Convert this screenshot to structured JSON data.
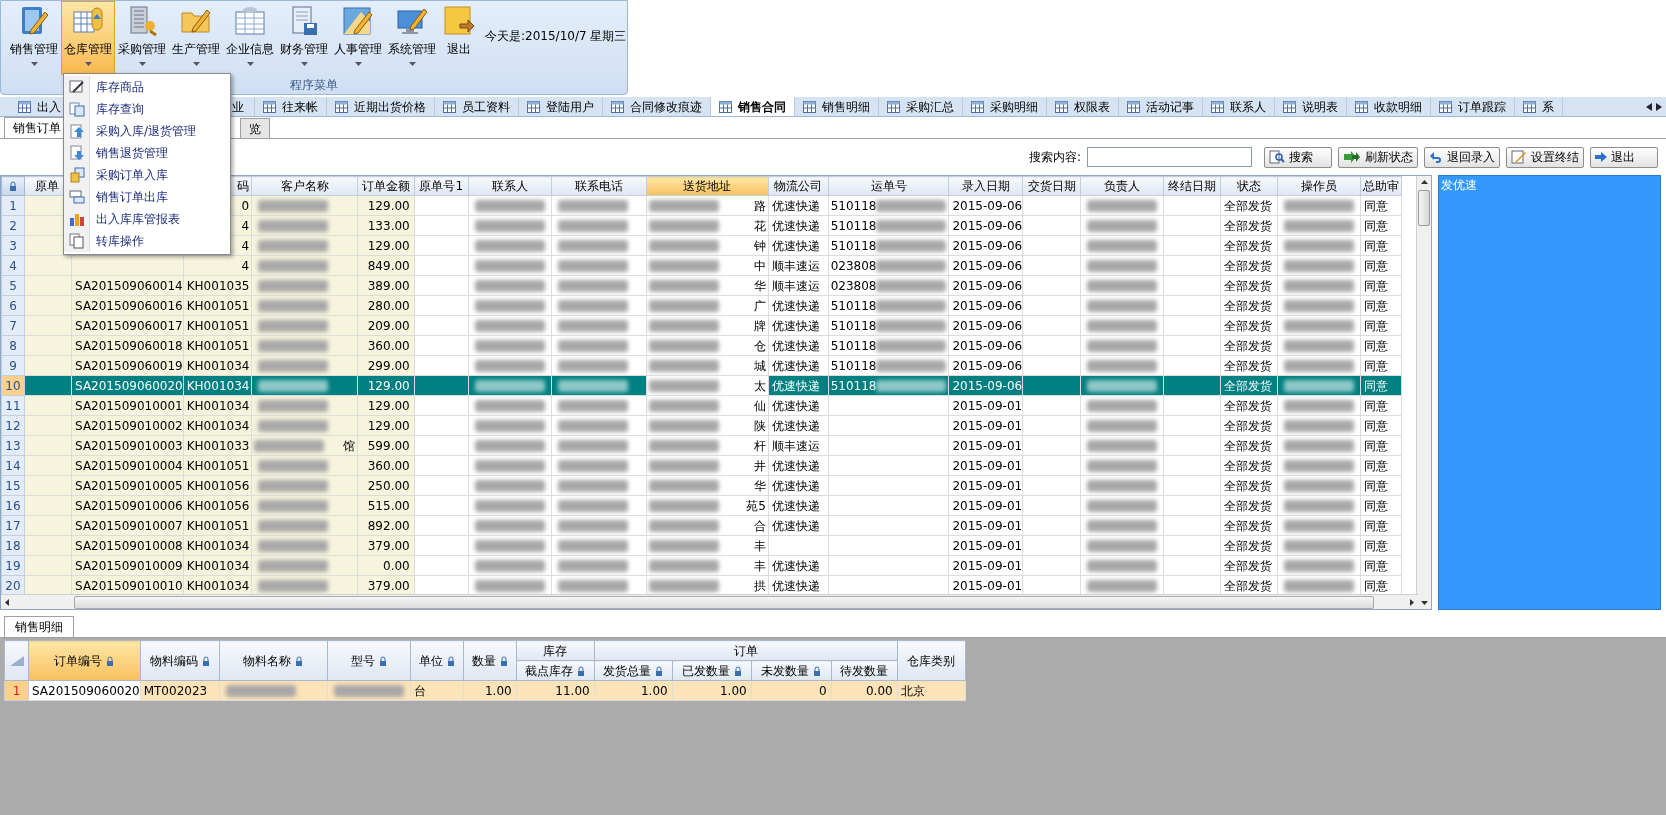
{
  "ribbon": {
    "buttons": [
      {
        "label": "销售管理",
        "selected": false,
        "dropdown": true
      },
      {
        "label": "仓库管理",
        "selected": true,
        "dropdown": true
      },
      {
        "label": "采购管理",
        "selected": false,
        "dropdown": true
      },
      {
        "label": "生产管理",
        "selected": false,
        "dropdown": true
      },
      {
        "label": "企业信息",
        "selected": false,
        "dropdown": true
      },
      {
        "label": "财务管理",
        "selected": false,
        "dropdown": true
      },
      {
        "label": "人事管理",
        "selected": false,
        "dropdown": true
      },
      {
        "label": "系统管理",
        "selected": false,
        "dropdown": true
      },
      {
        "label": "退出",
        "selected": false,
        "dropdown": false
      }
    ],
    "date": "今天是:2015/10/7 星期三",
    "group_label": "程序菜单"
  },
  "menu": {
    "items": [
      "库存商品",
      "库存查询",
      "采购入库/退货管理",
      "销售退货管理",
      "采购订单入库",
      "销售订单出库",
      "出入库库管报表",
      "转库操作"
    ]
  },
  "tabs": [
    {
      "label": "出入",
      "selected": false
    },
    {
      "label": "业",
      "selected": false
    },
    {
      "label": "往来帐",
      "selected": false
    },
    {
      "label": "近期出货价格",
      "selected": false
    },
    {
      "label": "员工资料",
      "selected": false
    },
    {
      "label": "登陆用户",
      "selected": false
    },
    {
      "label": "合同修改痕迹",
      "selected": false
    },
    {
      "label": "销售合同",
      "selected": true
    },
    {
      "label": "销售明细",
      "selected": false
    },
    {
      "label": "采购汇总",
      "selected": false
    },
    {
      "label": "采购明细",
      "selected": false
    },
    {
      "label": "权限表",
      "selected": false
    },
    {
      "label": "活动记事",
      "selected": false
    },
    {
      "label": "联系人",
      "selected": false
    },
    {
      "label": "说明表",
      "selected": false
    },
    {
      "label": "收款明细",
      "selected": false
    },
    {
      "label": "订单跟踪",
      "selected": false
    },
    {
      "label": "系",
      "selected": false
    }
  ],
  "sub_tabs": [
    {
      "label": "销售订单",
      "selected": true
    },
    {
      "label": "览",
      "selected": false
    }
  ],
  "toolbar": {
    "search_label": "搜索内容:",
    "buttons": [
      "搜索",
      "刷新状态",
      "退回录入",
      "设置终结",
      "退出"
    ]
  },
  "grid": {
    "columns": [
      {
        "label": "原单",
        "selected": false
      },
      {
        "selected": false
      },
      {
        "label": "码",
        "selected": false
      },
      {
        "label": "客户名称",
        "selected": false
      },
      {
        "label": "订单金额",
        "selected": false
      },
      {
        "label": "原单号1",
        "selected": false
      },
      {
        "label": "联系人",
        "selected": false
      },
      {
        "label": "联系电话",
        "selected": false
      },
      {
        "label": "送货地址",
        "selected": true
      },
      {
        "label": "物流公司",
        "selected": false
      },
      {
        "label": "运单号",
        "selected": false
      },
      {
        "label": "录入日期",
        "selected": false
      },
      {
        "label": "交货日期",
        "selected": false
      },
      {
        "label": "负责人",
        "selected": false
      },
      {
        "label": "终结日期",
        "selected": false
      },
      {
        "label": "状态",
        "selected": false
      },
      {
        "label": "操作员",
        "selected": false
      },
      {
        "label": "总助审",
        "selected": false
      }
    ],
    "rows": [
      {
        "number": "1",
        "selected": false,
        "cells": [
          null,
          null,
          "0",
          {
            "kind": "redacted"
          },
          "129.00",
          null,
          {
            "kind": "redacted"
          },
          {
            "kind": "redacted"
          },
          {
            "kind": "prefixed",
            "text": "路"
          },
          "优速快递",
          {
            "kind": "suffixed",
            "text": "510118"
          },
          "2015-09-06",
          null,
          {
            "kind": "redacted"
          },
          null,
          "全部发货",
          {
            "kind": "redacted"
          },
          "同意"
        ]
      },
      {
        "number": "2",
        "selected": false,
        "cells": [
          null,
          null,
          "4",
          {
            "kind": "redacted"
          },
          "133.00",
          null,
          {
            "kind": "redacted"
          },
          {
            "kind": "redacted"
          },
          {
            "kind": "prefixed",
            "text": "花"
          },
          "优速快递",
          {
            "kind": "suffixed",
            "text": "510118"
          },
          "2015-09-06",
          null,
          {
            "kind": "redacted"
          },
          null,
          "全部发货",
          {
            "kind": "redacted"
          },
          "同意"
        ]
      },
      {
        "number": "3",
        "selected": false,
        "cells": [
          null,
          null,
          "4",
          {
            "kind": "redacted"
          },
          "129.00",
          null,
          {
            "kind": "redacted"
          },
          {
            "kind": "redacted"
          },
          {
            "kind": "prefixed",
            "text": "钟"
          },
          "优速快递",
          {
            "kind": "suffixed",
            "text": "510118"
          },
          "2015-09-06",
          null,
          {
            "kind": "redacted"
          },
          null,
          "全部发货",
          {
            "kind": "redacted"
          },
          "同意"
        ]
      },
      {
        "number": "4",
        "selected": false,
        "cells": [
          null,
          null,
          "4",
          {
            "kind": "redacted"
          },
          "849.00",
          null,
          {
            "kind": "redacted"
          },
          {
            "kind": "redacted"
          },
          {
            "kind": "prefixed",
            "text": "中"
          },
          "顺丰速运",
          {
            "kind": "suffixed",
            "text": "023808"
          },
          "2015-09-06",
          null,
          {
            "kind": "redacted"
          },
          null,
          "全部发货",
          {
            "kind": "redacted"
          },
          "同意"
        ]
      },
      {
        "number": "5",
        "selected": false,
        "cells": [
          null,
          "SA201509060014",
          "KH001035",
          {
            "kind": "redacted"
          },
          "389.00",
          null,
          {
            "kind": "redacted"
          },
          {
            "kind": "redacted"
          },
          {
            "kind": "prefixed",
            "text": "华"
          },
          "顺丰速运",
          {
            "kind": "suffixed",
            "text": "023808"
          },
          "2015-09-06",
          null,
          {
            "kind": "redacted"
          },
          null,
          "全部发货",
          {
            "kind": "redacted"
          },
          "同意"
        ]
      },
      {
        "number": "6",
        "selected": false,
        "cells": [
          null,
          "SA201509060016",
          "KH001051",
          {
            "kind": "redacted"
          },
          "280.00",
          null,
          {
            "kind": "redacted"
          },
          {
            "kind": "redacted"
          },
          {
            "kind": "prefixed",
            "text": "广"
          },
          "优速快递",
          {
            "kind": "suffixed",
            "text": "510118"
          },
          "2015-09-06",
          null,
          {
            "kind": "redacted"
          },
          null,
          "全部发货",
          {
            "kind": "redacted"
          },
          "同意"
        ]
      },
      {
        "number": "7",
        "selected": false,
        "cells": [
          null,
          "SA201509060017",
          "KH001051",
          {
            "kind": "redacted"
          },
          "209.00",
          null,
          {
            "kind": "redacted"
          },
          {
            "kind": "redacted"
          },
          {
            "kind": "prefixed",
            "text": "牌"
          },
          "优速快递",
          {
            "kind": "suffixed",
            "text": "510118"
          },
          "2015-09-06",
          null,
          {
            "kind": "redacted"
          },
          null,
          "全部发货",
          {
            "kind": "redacted"
          },
          "同意"
        ]
      },
      {
        "number": "8",
        "selected": false,
        "cells": [
          null,
          "SA201509060018",
          "KH001051",
          {
            "kind": "redacted"
          },
          "360.00",
          null,
          {
            "kind": "redacted"
          },
          {
            "kind": "redacted"
          },
          {
            "kind": "prefixed",
            "text": "仓"
          },
          "优速快递",
          {
            "kind": "suffixed",
            "text": "510118"
          },
          "2015-09-06",
          null,
          {
            "kind": "redacted"
          },
          null,
          "全部发货",
          {
            "kind": "redacted"
          },
          "同意"
        ]
      },
      {
        "number": "9",
        "selected": false,
        "cells": [
          null,
          "SA201509060019",
          "KH001034",
          {
            "kind": "redacted"
          },
          "299.00",
          null,
          {
            "kind": "redacted"
          },
          {
            "kind": "redacted"
          },
          {
            "kind": "prefixed",
            "text": "城"
          },
          "优速快递",
          {
            "kind": "suffixed",
            "text": "510118"
          },
          "2015-09-06",
          null,
          {
            "kind": "redacted"
          },
          null,
          "全部发货",
          {
            "kind": "redacted"
          },
          "同意"
        ]
      },
      {
        "number": "10",
        "selected": true,
        "cells": [
          null,
          "SA201509060020",
          "KH001034",
          {
            "kind": "redacted"
          },
          "129.00",
          null,
          {
            "kind": "redacted"
          },
          {
            "kind": "redacted"
          },
          {
            "kind": "prefixed",
            "text": "太"
          },
          "优速快递",
          {
            "kind": "suffixed",
            "text": "510118"
          },
          "2015-09-06",
          null,
          {
            "kind": "redacted"
          },
          null,
          "全部发货",
          {
            "kind": "redacted"
          },
          "同意"
        ]
      },
      {
        "number": "11",
        "selected": false,
        "cells": [
          null,
          "SA201509010001",
          "KH001034",
          {
            "kind": "redacted"
          },
          "129.00",
          null,
          {
            "kind": "redacted"
          },
          {
            "kind": "redacted"
          },
          {
            "kind": "prefixed",
            "text": "仙"
          },
          "优速快递",
          null,
          "2015-09-01",
          null,
          {
            "kind": "redacted"
          },
          null,
          "全部发货",
          {
            "kind": "redacted"
          },
          "同意"
        ]
      },
      {
        "number": "12",
        "selected": false,
        "cells": [
          null,
          "SA201509010002",
          "KH001034",
          {
            "kind": "redacted"
          },
          "129.00",
          null,
          {
            "kind": "redacted"
          },
          {
            "kind": "redacted"
          },
          {
            "kind": "prefixed",
            "text": "陕"
          },
          "优速快递",
          null,
          "2015-09-01",
          null,
          {
            "kind": "redacted"
          },
          null,
          "全部发货",
          {
            "kind": "redacted"
          },
          "同意"
        ]
      },
      {
        "number": "13",
        "selected": false,
        "cells": [
          null,
          "SA201509010003",
          "KH001033",
          {
            "kind": "prefixed",
            "text": "馆"
          },
          "599.00",
          null,
          {
            "kind": "redacted"
          },
          {
            "kind": "redacted"
          },
          {
            "kind": "prefixed",
            "text": "杆"
          },
          "顺丰速运",
          null,
          "2015-09-01",
          null,
          {
            "kind": "redacted"
          },
          null,
          "全部发货",
          {
            "kind": "redacted"
          },
          "同意"
        ]
      },
      {
        "number": "14",
        "selected": false,
        "cells": [
          null,
          "SA201509010004",
          "KH001051",
          {
            "kind": "redacted"
          },
          "360.00",
          null,
          {
            "kind": "redacted"
          },
          {
            "kind": "redacted"
          },
          {
            "kind": "prefixed",
            "text": "井"
          },
          "优速快递",
          null,
          "2015-09-01",
          null,
          {
            "kind": "redacted"
          },
          null,
          "全部发货",
          {
            "kind": "redacted"
          },
          "同意"
        ]
      },
      {
        "number": "15",
        "selected": false,
        "cells": [
          null,
          "SA201509010005",
          "KH001056",
          {
            "kind": "redacted"
          },
          "250.00",
          null,
          {
            "kind": "redacted"
          },
          {
            "kind": "redacted"
          },
          {
            "kind": "prefixed",
            "text": "华"
          },
          "优速快递",
          null,
          "2015-09-01",
          null,
          {
            "kind": "redacted"
          },
          null,
          "全部发货",
          {
            "kind": "redacted"
          },
          "同意"
        ]
      },
      {
        "number": "16",
        "selected": false,
        "cells": [
          null,
          "SA201509010006",
          "KH001056",
          {
            "kind": "redacted"
          },
          "515.00",
          null,
          {
            "kind": "redacted"
          },
          {
            "kind": "redacted"
          },
          {
            "kind": "prefixed",
            "text": "苑5"
          },
          "优速快递",
          null,
          "2015-09-01",
          null,
          {
            "kind": "redacted"
          },
          null,
          "全部发货",
          {
            "kind": "redacted"
          },
          "同意"
        ]
      },
      {
        "number": "17",
        "selected": false,
        "cells": [
          null,
          "SA201509010007",
          "KH001051",
          {
            "kind": "redacted"
          },
          "892.00",
          null,
          {
            "kind": "redacted"
          },
          {
            "kind": "redacted"
          },
          {
            "kind": "prefixed",
            "text": "合"
          },
          "优速快递",
          null,
          "2015-09-01",
          null,
          {
            "kind": "redacted"
          },
          null,
          "全部发货",
          {
            "kind": "redacted"
          },
          "同意"
        ]
      },
      {
        "number": "18",
        "selected": false,
        "cells": [
          null,
          "SA201509010008",
          "KH001034",
          {
            "kind": "redacted"
          },
          "379.00",
          null,
          {
            "kind": "redacted"
          },
          {
            "kind": "redacted"
          },
          {
            "kind": "prefixed",
            "text": "丰"
          },
          null,
          null,
          "2015-09-01",
          null,
          {
            "kind": "redacted"
          },
          null,
          "全部发货",
          {
            "kind": "redacted"
          },
          "同意"
        ]
      },
      {
        "number": "19",
        "selected": false,
        "cells": [
          null,
          "SA201509010009",
          "KH001034",
          {
            "kind": "redacted"
          },
          "0.00",
          null,
          {
            "kind": "redacted"
          },
          {
            "kind": "redacted"
          },
          {
            "kind": "prefixed",
            "text": "丰"
          },
          "优速快递",
          null,
          "2015-09-01",
          null,
          {
            "kind": "redacted"
          },
          null,
          "全部发货",
          {
            "kind": "redacted"
          },
          "同意"
        ]
      },
      {
        "number": "20",
        "selected": false,
        "cells": [
          null,
          "SA201509010010",
          "KH001034",
          {
            "kind": "redacted"
          },
          "379.00",
          null,
          {
            "kind": "redacted"
          },
          {
            "kind": "redacted"
          },
          {
            "kind": "prefixed",
            "text": "拱"
          },
          "优速快递",
          null,
          "2015-09-01",
          null,
          {
            "kind": "redacted"
          },
          null,
          "全部发货",
          {
            "kind": "redacted"
          },
          "同意"
        ]
      }
    ]
  },
  "side_panel": {
    "text": "发优速"
  },
  "detail": {
    "tab": "销售明细",
    "header": [
      {
        "kind": "column",
        "label": "订单编号",
        "lock": true,
        "selected": true
      },
      {
        "kind": "column",
        "label": "物料编码",
        "lock": true,
        "selected": false
      },
      {
        "kind": "column",
        "label": "物料名称",
        "lock": true,
        "selected": false
      },
      {
        "kind": "column",
        "label": "型号",
        "lock": true,
        "selected": false
      },
      {
        "kind": "column",
        "label": "单位",
        "lock": true,
        "selected": false
      },
      {
        "kind": "column",
        "label": "数量",
        "lock": true,
        "selected": false
      },
      {
        "kind": "group",
        "label": "库存",
        "columns": [
          {
            "label": "截点库存",
            "lock": true
          }
        ]
      },
      {
        "kind": "group",
        "label": "订单",
        "columns": [
          {
            "label": "发货总量",
            "lock": true
          },
          {
            "label": "已发数量",
            "lock": true
          },
          {
            "label": "未发数量",
            "lock": true
          },
          {
            "label": "待发数量",
            "lock": false
          }
        ]
      },
      {
        "kind": "column",
        "label": "仓库类别",
        "lock": false,
        "selected": false
      }
    ],
    "rows": [
      {
        "number": "1",
        "cells": [
          "SA201509060020",
          "MT002023",
          {
            "kind": "redacted"
          },
          {
            "kind": "redacted"
          },
          "台",
          "1.00",
          "11.00",
          "1.00",
          "1.00",
          "0",
          "0.00",
          "北京"
        ]
      }
    ]
  }
}
